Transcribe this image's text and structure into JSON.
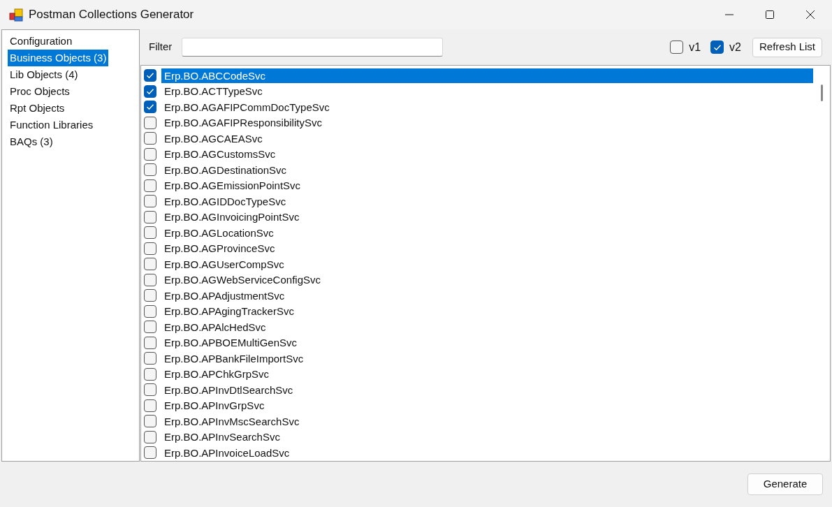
{
  "window": {
    "title": "Postman Collections Generator"
  },
  "sidebar": {
    "items": [
      {
        "label": "Configuration",
        "selected": false
      },
      {
        "label": "Business Objects (3)",
        "selected": true
      },
      {
        "label": "Lib Objects (4)",
        "selected": false
      },
      {
        "label": "Proc Objects",
        "selected": false
      },
      {
        "label": "Rpt Objects",
        "selected": false
      },
      {
        "label": "Function Libraries",
        "selected": false
      },
      {
        "label": "BAQs (3)",
        "selected": false
      }
    ]
  },
  "toolbar": {
    "filter_label": "Filter",
    "versions": [
      {
        "label": "v1",
        "checked": false
      },
      {
        "label": "v2",
        "checked": true
      }
    ],
    "refresh_button": "Refresh List"
  },
  "services": [
    {
      "name": "Erp.BO.ABCCodeSvc",
      "checked": true,
      "selected": true
    },
    {
      "name": "Erp.BO.ACTTypeSvc",
      "checked": true,
      "selected": false
    },
    {
      "name": "Erp.BO.AGAFIPCommDocTypeSvc",
      "checked": true,
      "selected": false
    },
    {
      "name": "Erp.BO.AGAFIPResponsibilitySvc",
      "checked": false,
      "selected": false
    },
    {
      "name": "Erp.BO.AGCAEASvc",
      "checked": false,
      "selected": false
    },
    {
      "name": "Erp.BO.AGCustomsSvc",
      "checked": false,
      "selected": false
    },
    {
      "name": "Erp.BO.AGDestinationSvc",
      "checked": false,
      "selected": false
    },
    {
      "name": "Erp.BO.AGEmissionPointSvc",
      "checked": false,
      "selected": false
    },
    {
      "name": "Erp.BO.AGIDDocTypeSvc",
      "checked": false,
      "selected": false
    },
    {
      "name": "Erp.BO.AGInvoicingPointSvc",
      "checked": false,
      "selected": false
    },
    {
      "name": "Erp.BO.AGLocationSvc",
      "checked": false,
      "selected": false
    },
    {
      "name": "Erp.BO.AGProvinceSvc",
      "checked": false,
      "selected": false
    },
    {
      "name": "Erp.BO.AGUserCompSvc",
      "checked": false,
      "selected": false
    },
    {
      "name": "Erp.BO.AGWebServiceConfigSvc",
      "checked": false,
      "selected": false
    },
    {
      "name": "Erp.BO.APAdjustmentSvc",
      "checked": false,
      "selected": false
    },
    {
      "name": "Erp.BO.APAgingTrackerSvc",
      "checked": false,
      "selected": false
    },
    {
      "name": "Erp.BO.APAlcHedSvc",
      "checked": false,
      "selected": false
    },
    {
      "name": "Erp.BO.APBOEMultiGenSvc",
      "checked": false,
      "selected": false
    },
    {
      "name": "Erp.BO.APBankFileImportSvc",
      "checked": false,
      "selected": false
    },
    {
      "name": "Erp.BO.APChkGrpSvc",
      "checked": false,
      "selected": false
    },
    {
      "name": "Erp.BO.APInvDtlSearchSvc",
      "checked": false,
      "selected": false
    },
    {
      "name": "Erp.BO.APInvGrpSvc",
      "checked": false,
      "selected": false
    },
    {
      "name": "Erp.BO.APInvMscSearchSvc",
      "checked": false,
      "selected": false
    },
    {
      "name": "Erp.BO.APInvSearchSvc",
      "checked": false,
      "selected": false
    },
    {
      "name": "Erp.BO.APInvoiceLoadSvc",
      "checked": false,
      "selected": false
    }
  ],
  "footer": {
    "generate_button": "Generate"
  }
}
